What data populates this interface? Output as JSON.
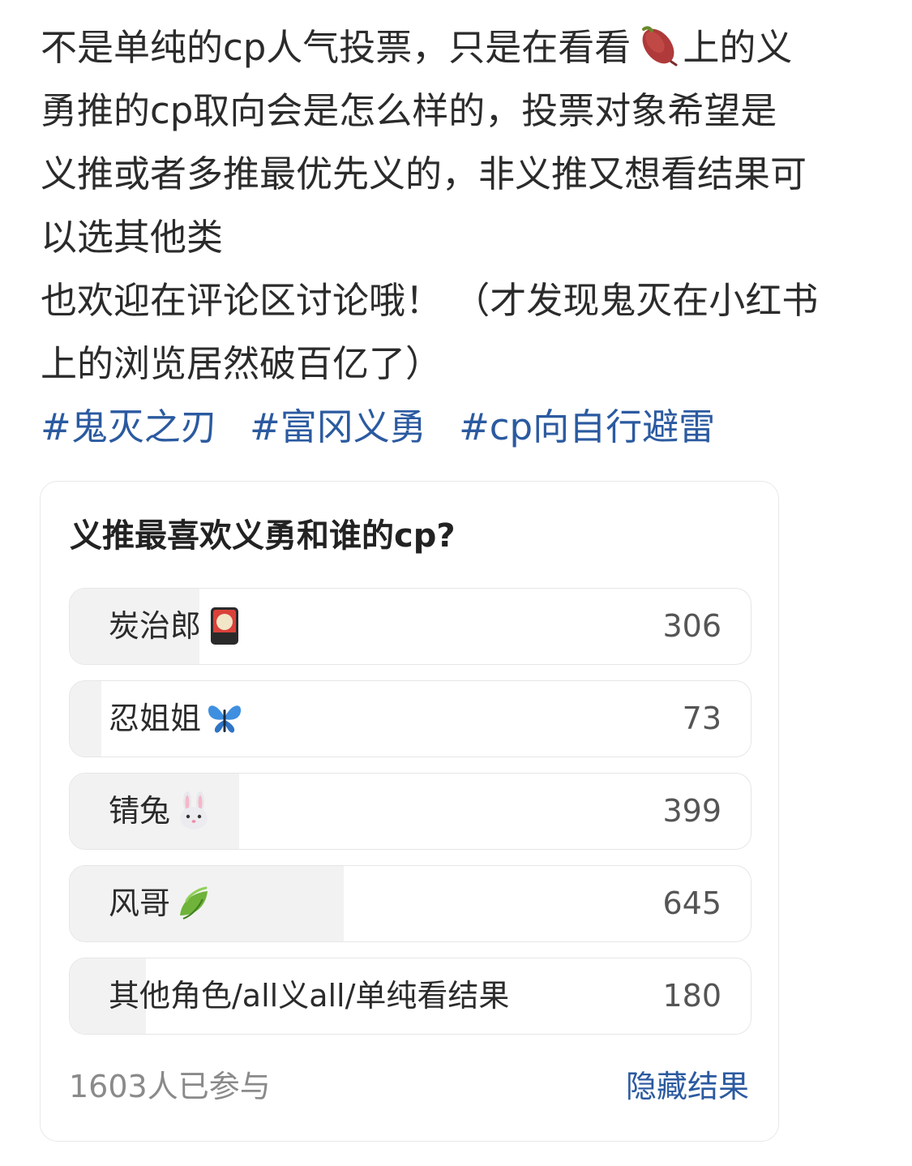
{
  "post": {
    "lines": [
      [
        "不是单纯的cp人气投票，只是在看看",
        "上的义"
      ],
      [
        "勇推的cp取向会是怎么样的，投票对象希望是"
      ],
      [
        "义推或者多推最优先义的，非义推又想看结果可"
      ],
      [
        "以选其他类"
      ],
      [
        "也欢迎在评论区讨论哦！  （才发现鬼灭在小红书"
      ],
      [
        "上的浏览居然破百亿了）"
      ]
    ],
    "inline_icon": "sweet-potato-icon"
  },
  "tags": [
    "#鬼灭之刃",
    "#富冈义勇",
    "#cp向自行避雷"
  ],
  "poll": {
    "title": "义推最喜欢义勇和谁的cp?",
    "total": 1603,
    "options": [
      {
        "label": "炭治郎",
        "icon": "hanafuda-earring-icon",
        "count": "306",
        "share": 0.191
      },
      {
        "label": "忍姐姐",
        "icon": "butterfly-icon",
        "count": "73",
        "share": 0.046
      },
      {
        "label": "锖兔",
        "icon": "rabbit-icon",
        "count": "399",
        "share": 0.249
      },
      {
        "label": "风哥",
        "icon": "leaf-icon",
        "count": "645",
        "share": 0.402
      },
      {
        "label": "其他角色/all义all/单纯看结果",
        "icon": "",
        "count": "180",
        "share": 0.112
      }
    ],
    "participants_text": "1603人已参与",
    "hide_results_label": "隐藏结果"
  },
  "colors": {
    "tag": "#2b5aa0",
    "fill": "#f2f2f2",
    "muted": "#8a8a8a"
  }
}
